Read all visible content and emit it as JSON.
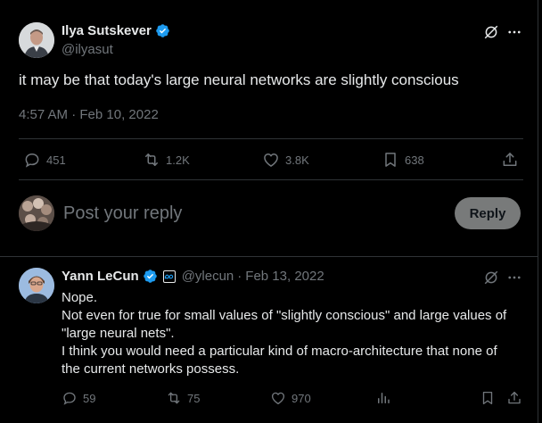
{
  "main_tweet": {
    "author_name": "Ilya Sutskever",
    "author_handle": "@ilyasut",
    "text": "it may be that today's large neural networks are slightly conscious",
    "time": "4:57 AM",
    "date_sep": "·",
    "date": "Feb 10, 2022",
    "stats": {
      "replies": "451",
      "reposts": "1.2K",
      "likes": "3.8K",
      "bookmarks": "638"
    }
  },
  "composer": {
    "placeholder": "Post your reply",
    "reply_button": "Reply"
  },
  "reply_tweet": {
    "author_name": "Yann LeCun",
    "author_handle": "@ylecun",
    "date_sep": "·",
    "date": "Feb 13, 2022",
    "lines": [
      "Nope.",
      "Not even for true for small values of \"slightly conscious\" and large values of",
      "\"large neural nets\".",
      "I think you would need a particular kind of macro-architecture that none of",
      "the current networks possess."
    ],
    "stats": {
      "replies": "59",
      "reposts": "75",
      "likes": "970"
    }
  },
  "colors": {
    "background": "#000000",
    "text": "#e7e9ea",
    "muted": "#71767b",
    "verified": "#1d9bf0",
    "divider": "#2f3336",
    "reply_button_bg": "#787a7a"
  }
}
